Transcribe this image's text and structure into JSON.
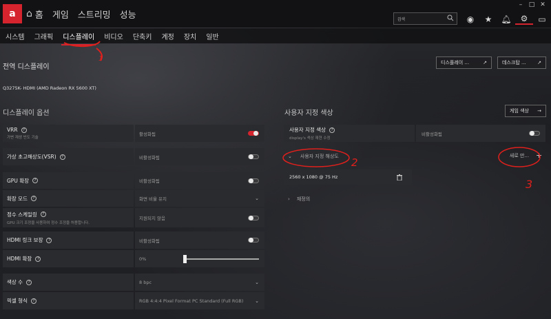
{
  "nav": {
    "home": "홈",
    "gaming": "게임",
    "streaming": "스트리밍",
    "performance": "성능"
  },
  "search": {
    "placeholder": "검색"
  },
  "top_icons": [
    "globe-icon",
    "star-icon",
    "bell-icon",
    "gear-icon",
    "monitor-icon"
  ],
  "subnav": [
    "시스템",
    "그래픽",
    "디스플레이",
    "비디오",
    "단축키",
    "계정",
    "장치",
    "일반"
  ],
  "global": {
    "title": "전역 디스플레이",
    "display_btn": "디스플레이 ...",
    "desktop_btn": "데스크탑 ...",
    "monitor": "Q3275K- HDMI (AMD Radeon RX 5600 XT)"
  },
  "display_options": {
    "title": "디스플레이 옵션",
    "rows": [
      {
        "label": "VRR",
        "sub": "가변 재생 빈도 기술",
        "value": "활성화됨"
      },
      {
        "label": "가상 초고해상도(VSR)",
        "sub": "",
        "value": "비활성화됨"
      },
      {
        "label": "GPU 확장",
        "sub": "",
        "value": "비활성화됨"
      },
      {
        "label": "확장 모드",
        "sub": "",
        "value": "화면 비율 유지"
      },
      {
        "label": "정수 스케일링",
        "sub": "GPU 크기 조정을 사용하여 정수 조정을 허용합니다.",
        "value": "지원되지 않음"
      },
      {
        "label": "HDMI 링크 보장",
        "sub": "",
        "value": "비활성화됨"
      },
      {
        "label": "HDMI 확장",
        "sub": "",
        "value": "0%"
      },
      {
        "label": "색상 수",
        "sub": "",
        "value": "8 bpc"
      },
      {
        "label": "픽셀 형식",
        "sub": "",
        "value": "RGB 4:4:4 Pixel Format PC Standard (Full RGB)"
      }
    ]
  },
  "custom_color": {
    "title": "사용자 지정 색상",
    "game_color_btn": "게임 색상",
    "label": "사용자 지정 색상",
    "sub": "display's 색상 재현 수정",
    "value": "비활성화됨"
  },
  "custom_resolution": {
    "label": "사용자 지정 해상도",
    "new_btn": "새로 만...",
    "entry": "2560 x 1080 @ 75 Hz",
    "settings": "재정의"
  },
  "annotations": [
    "1",
    "2",
    "3"
  ],
  "colors": {
    "accent": "#d6242e",
    "annotation": "#e0201c"
  }
}
